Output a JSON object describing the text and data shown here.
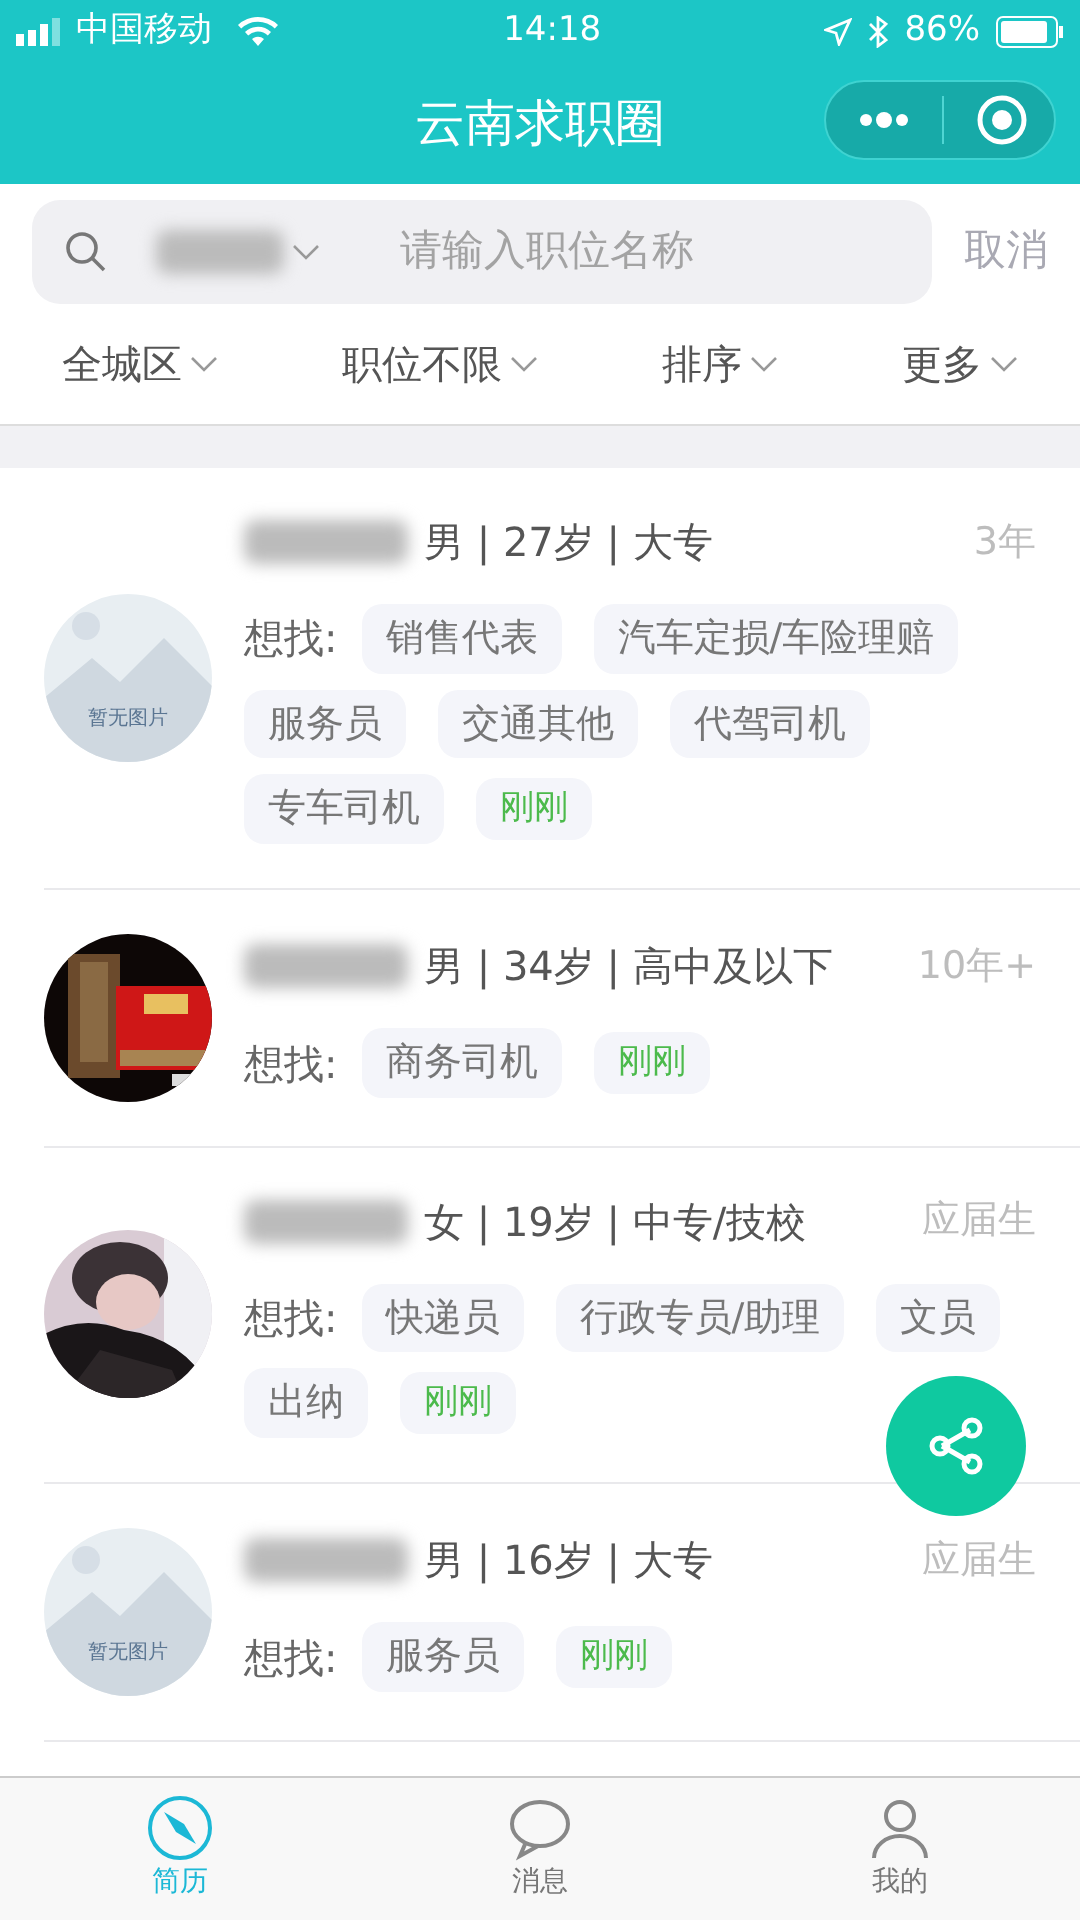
{
  "status_bar": {
    "carrier": "中国移动",
    "time": "14:18",
    "battery": "86%"
  },
  "header": {
    "title": "云南求职圈"
  },
  "search": {
    "placeholder": "请输入职位名称",
    "cancel": "取消"
  },
  "filters": [
    {
      "label": "全城区"
    },
    {
      "label": "职位不限"
    },
    {
      "label": "排序"
    },
    {
      "label": "更多"
    }
  ],
  "resumes": [
    {
      "avatar": {
        "kind": "placeholder",
        "text": "暂无图片"
      },
      "info": "男 | 27岁 | 大专",
      "experience": "3年",
      "want_label": "想找:",
      "tags": [
        {
          "kind": "job",
          "text": "销售代表"
        },
        {
          "kind": "job",
          "text": "汽车定损/车险理赔"
        },
        {
          "kind": "job",
          "text": "服务员"
        },
        {
          "kind": "job",
          "text": "交通其他"
        },
        {
          "kind": "job",
          "text": "代驾司机"
        },
        {
          "kind": "job",
          "text": "专车司机"
        },
        {
          "kind": "time",
          "text": "刚刚"
        }
      ]
    },
    {
      "avatar": {
        "kind": "picture"
      },
      "info": "男 | 34岁 | 高中及以下",
      "experience": "10年+",
      "want_label": "想找:",
      "tags": [
        {
          "kind": "job",
          "text": "商务司机"
        },
        {
          "kind": "time",
          "text": "刚刚"
        }
      ]
    },
    {
      "avatar": {
        "kind": "picture"
      },
      "info": "女 | 19岁 | 中专/技校",
      "experience": "应届生",
      "want_label": "想找:",
      "tags": [
        {
          "kind": "job",
          "text": "快递员"
        },
        {
          "kind": "job",
          "text": "行政专员/助理"
        },
        {
          "kind": "job",
          "text": "文员"
        },
        {
          "kind": "job",
          "text": "出纳"
        },
        {
          "kind": "time",
          "text": "刚刚"
        }
      ]
    },
    {
      "avatar": {
        "kind": "placeholder",
        "text": "暂无图片"
      },
      "info": "男 | 16岁 | 大专",
      "experience": "应届生",
      "want_label": "想找:",
      "tags": [
        {
          "kind": "job",
          "text": "服务员"
        },
        {
          "kind": "time",
          "text": "刚刚"
        }
      ]
    }
  ],
  "tab_bar": [
    {
      "label": "简历",
      "selected": true
    },
    {
      "label": "消息",
      "selected": false
    },
    {
      "label": "我的",
      "selected": false
    }
  ]
}
